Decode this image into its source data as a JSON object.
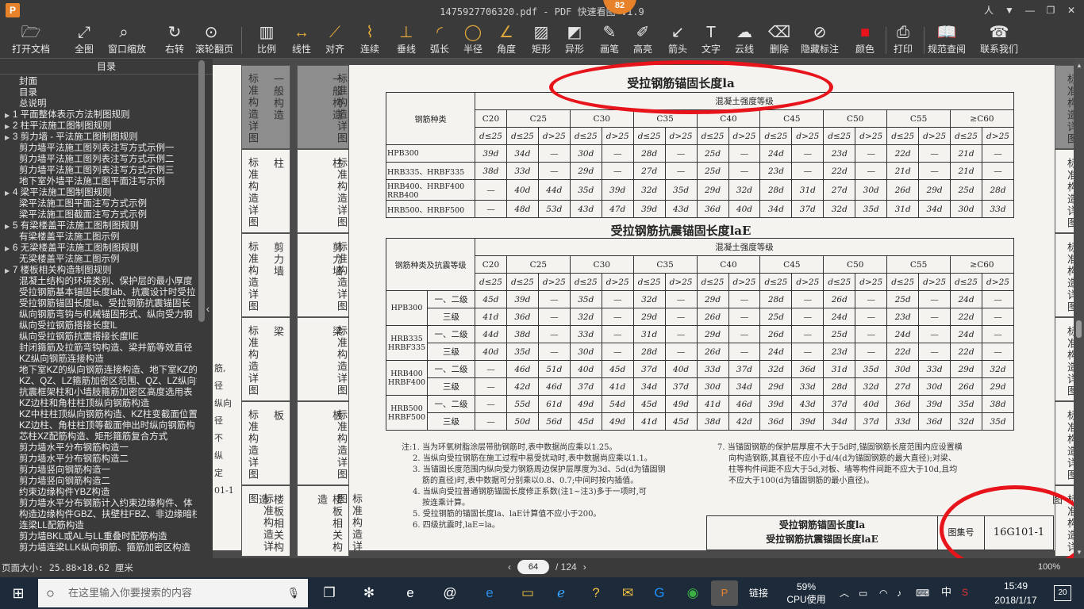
{
  "window": {
    "logo": "P",
    "title": "1475927706320.pdf - PDF 快速看图 v1.9",
    "badge": "82",
    "controls": [
      "人",
      "▼",
      "—",
      "❐",
      "✕"
    ]
  },
  "toolbar": [
    {
      "icon": "🗁",
      "label": "打开文档",
      "name": "open-document"
    },
    {
      "icon": "⤢",
      "label": "全图",
      "name": "fit-all"
    },
    {
      "icon": "⌕",
      "label": "窗口缩放",
      "name": "window-zoom"
    },
    {
      "icon": "↻",
      "label": "右转",
      "name": "rotate-right"
    },
    {
      "icon": "⊙",
      "label": "滚轮翻页",
      "name": "wheel-page"
    },
    {
      "icon": "▥",
      "label": "比例",
      "name": "scale"
    },
    {
      "icon": "↔",
      "label": "线性",
      "name": "linear"
    },
    {
      "icon": "⟋",
      "label": "对齐",
      "name": "align"
    },
    {
      "icon": "⌇",
      "label": "连续",
      "name": "continuous"
    },
    {
      "icon": "⊥",
      "label": "垂线",
      "name": "perpendicular"
    },
    {
      "icon": "◜",
      "label": "弧长",
      "name": "arc-length"
    },
    {
      "icon": "◯",
      "label": "半径",
      "name": "radius"
    },
    {
      "icon": "∠",
      "label": "角度",
      "name": "angle"
    },
    {
      "icon": "▨",
      "label": "矩形",
      "name": "rectangle"
    },
    {
      "icon": "◩",
      "label": "异形",
      "name": "irregular"
    },
    {
      "icon": "✎",
      "label": "画笔",
      "name": "brush"
    },
    {
      "icon": "✐",
      "label": "高亮",
      "name": "highlight"
    },
    {
      "icon": "↙",
      "label": "箭头",
      "name": "arrow"
    },
    {
      "icon": "T",
      "label": "文字",
      "name": "text"
    },
    {
      "icon": "☁",
      "label": "云线",
      "name": "cloud"
    },
    {
      "icon": "⌫",
      "label": "删除",
      "name": "delete"
    },
    {
      "icon": "⊘",
      "label": "隐藏标注",
      "name": "hide-annotation"
    },
    {
      "icon": "■",
      "label": "颜色",
      "name": "color"
    },
    {
      "icon": "⎙",
      "label": "打印",
      "name": "print"
    },
    {
      "icon": "📖",
      "label": "规范查阅",
      "name": "spec-lookup"
    },
    {
      "icon": "☎",
      "label": "联系我们",
      "name": "contact-us"
    }
  ],
  "sidebar": {
    "title": "目录",
    "items": [
      {
        "t": "封面",
        "c": false
      },
      {
        "t": "目录",
        "c": false
      },
      {
        "t": "总说明",
        "c": false
      },
      {
        "t": "1 平面整体表示方法制图规则",
        "c": true
      },
      {
        "t": "2 柱平法施工图制图规则",
        "c": true
      },
      {
        "t": "3 剪力墙 - 平法施工图制图规则",
        "c": true
      },
      {
        "t": "剪力墙平法施工图列表注写方式示例一",
        "c": false
      },
      {
        "t": "剪力墙平法施工图列表注写方式示例二",
        "c": false
      },
      {
        "t": "剪力墙平法施工图列表注写方式示例三",
        "c": false
      },
      {
        "t": "地下室外墙平法施工图平面注写示例",
        "c": false
      },
      {
        "t": "4 梁平法施工图制图规则",
        "c": true
      },
      {
        "t": "梁平法施工图平面注写方式示例",
        "c": false
      },
      {
        "t": "梁平法施工图截面注写方式示例",
        "c": false
      },
      {
        "t": "5 有梁楼盖平法施工图制图规则",
        "c": true
      },
      {
        "t": "有梁楼盖平法施工图示例",
        "c": false
      },
      {
        "t": "6 无梁楼盖平法施工图制图规则",
        "c": true
      },
      {
        "t": "无梁楼盖平法施工图示例",
        "c": false
      },
      {
        "t": "7 楼板相关构造制图规则",
        "c": true
      },
      {
        "t": "混凝土结构的环境类别、保护层的最小厚度",
        "c": false
      },
      {
        "t": "受拉钢筋基本锚固长度lab、抗震设计时受拉",
        "c": false
      },
      {
        "t": "受拉钢筋锚固长度la、受拉钢筋抗震锚固长",
        "c": false
      },
      {
        "t": "纵向钢筋弯钩与机械锚固形式、纵向受力钢",
        "c": false
      },
      {
        "t": "纵向受拉钢筋搭接长度lL",
        "c": false
      },
      {
        "t": "纵向受拉钢筋抗震搭接长度llE",
        "c": false
      },
      {
        "t": "封闭箍筋及拉筋弯钩构造、梁并筋等效直径",
        "c": false
      },
      {
        "t": "KZ纵向钢筋连接构造",
        "c": false
      },
      {
        "t": "地下室KZ的纵向钢筋连接构造、地下室KZ的",
        "c": false
      },
      {
        "t": "KZ、QZ、LZ箍筋加密区范围、QZ、LZ纵向钢",
        "c": false
      },
      {
        "t": "抗震框架柱和小墙肢箍筋加密区高度选用表",
        "c": false
      },
      {
        "t": "KZ边柱和角柱柱顶纵向钢筋构造",
        "c": false
      },
      {
        "t": "KZ中柱柱顶纵向钢筋构造、KZ柱变截面位置",
        "c": false
      },
      {
        "t": "KZ边柱、角柱柱顶等截面伸出时纵向钢筋构",
        "c": false
      },
      {
        "t": "芯柱XZ配筋构造、矩形箍筋复合方式",
        "c": false
      },
      {
        "t": "剪力墙水平分布钢筋构造一",
        "c": false
      },
      {
        "t": "剪力墙水平分布钢筋构造二",
        "c": false
      },
      {
        "t": "剪力墙竖向钢筋构造一",
        "c": false
      },
      {
        "t": "剪力墙竖向钢筋构造二",
        "c": false
      },
      {
        "t": "约束边缘构件YBZ构造",
        "c": false
      },
      {
        "t": "剪力墙水平分布钢筋计入约束边缘构件、体",
        "c": false
      },
      {
        "t": "构造边缘构件GBZ、扶壁柱FBZ、非边缘暗柱",
        "c": false
      },
      {
        "t": "连梁LL配筋构造",
        "c": false
      },
      {
        "t": "剪力墙BKL或AL与LL重叠时配筋构造",
        "c": false
      },
      {
        "t": "剪力墙连梁LLK纵向钢筋、箍筋加密区构造",
        "c": false
      }
    ]
  },
  "page": {
    "side_tabs": [
      "标准构造详图",
      "柱",
      "剪力墙",
      "梁",
      "板",
      "楼板相关构造"
    ],
    "side_tab_heads": [
      "一般构造",
      "柱",
      "剪力墙",
      "梁",
      "板",
      "楼板相关构造"
    ],
    "left_fragments": [
      "筋,",
      "径",
      "纵向",
      "径",
      "不",
      "纵",
      "定",
      "01-1"
    ],
    "title1": "受拉钢筋锚固长度la",
    "title2": "受拉钢筋抗震锚固长度laE",
    "concrete_grade": "混凝土强度等级",
    "bar_type": "钢筋种类",
    "bar_type_seismic": "钢筋种类及抗震等级",
    "grades": [
      "C20",
      "C25",
      "C30",
      "C35",
      "C40",
      "C45",
      "C50",
      "C55",
      "≥C60"
    ],
    "d_le": "d≤25",
    "d_gt": "d>25",
    "table1": [
      {
        "type": "HPB300",
        "cells": [
          "39d",
          "34d",
          "—",
          "30d",
          "—",
          "28d",
          "—",
          "25d",
          "—",
          "24d",
          "—",
          "23d",
          "—",
          "22d",
          "—",
          "21d",
          "—"
        ]
      },
      {
        "type": "HRB335、HRBF335",
        "cells": [
          "38d",
          "33d",
          "—",
          "29d",
          "—",
          "27d",
          "—",
          "25d",
          "—",
          "23d",
          "—",
          "22d",
          "—",
          "21d",
          "—",
          "21d",
          "—"
        ]
      },
      {
        "type": "HRB400、HRBF400 RRB400",
        "cells": [
          "—",
          "40d",
          "44d",
          "35d",
          "39d",
          "32d",
          "35d",
          "29d",
          "32d",
          "28d",
          "31d",
          "27d",
          "30d",
          "26d",
          "29d",
          "25d",
          "28d"
        ]
      },
      {
        "type": "HRB500、HRBF500",
        "cells": [
          "—",
          "48d",
          "53d",
          "43d",
          "47d",
          "39d",
          "43d",
          "36d",
          "40d",
          "34d",
          "37d",
          "32d",
          "35d",
          "31d",
          "34d",
          "30d",
          "33d"
        ]
      }
    ],
    "table2": [
      {
        "type": "HPB300",
        "rows": [
          {
            "lvl": "一、二级",
            "cells": [
              "45d",
              "39d",
              "—",
              "35d",
              "—",
              "32d",
              "—",
              "29d",
              "—",
              "28d",
              "—",
              "26d",
              "—",
              "25d",
              "—",
              "24d",
              "—"
            ]
          },
          {
            "lvl": "三级",
            "cells": [
              "41d",
              "36d",
              "—",
              "32d",
              "—",
              "29d",
              "—",
              "26d",
              "—",
              "25d",
              "—",
              "24d",
              "—",
              "23d",
              "—",
              "22d",
              "—"
            ]
          }
        ]
      },
      {
        "type": "HRB335 HRBF335",
        "rows": [
          {
            "lvl": "一、二级",
            "cells": [
              "44d",
              "38d",
              "—",
              "33d",
              "—",
              "31d",
              "—",
              "29d",
              "—",
              "26d",
              "—",
              "25d",
              "—",
              "24d",
              "—",
              "24d",
              "—"
            ]
          },
          {
            "lvl": "三级",
            "cells": [
              "40d",
              "35d",
              "—",
              "30d",
              "—",
              "28d",
              "—",
              "26d",
              "—",
              "24d",
              "—",
              "23d",
              "—",
              "22d",
              "—",
              "22d",
              "—"
            ]
          }
        ]
      },
      {
        "type": "HRB400 HRBF400",
        "rows": [
          {
            "lvl": "一、二级",
            "cells": [
              "—",
              "46d",
              "51d",
              "40d",
              "45d",
              "37d",
              "40d",
              "33d",
              "37d",
              "32d",
              "36d",
              "31d",
              "35d",
              "30d",
              "33d",
              "29d",
              "32d"
            ]
          },
          {
            "lvl": "三级",
            "cells": [
              "—",
              "42d",
              "46d",
              "37d",
              "41d",
              "34d",
              "37d",
              "30d",
              "34d",
              "29d",
              "33d",
              "28d",
              "32d",
              "27d",
              "30d",
              "26d",
              "29d"
            ]
          }
        ]
      },
      {
        "type": "HRB500 HRBF500",
        "rows": [
          {
            "lvl": "一、二级",
            "cells": [
              "—",
              "55d",
              "61d",
              "49d",
              "54d",
              "45d",
              "49d",
              "41d",
              "46d",
              "39d",
              "43d",
              "37d",
              "40d",
              "36d",
              "39d",
              "35d",
              "38d"
            ]
          },
          {
            "lvl": "三级",
            "cells": [
              "—",
              "50d",
              "56d",
              "45d",
              "49d",
              "41d",
              "45d",
              "38d",
              "42d",
              "36d",
              "39d",
              "34d",
              "37d",
              "33d",
              "36d",
              "32d",
              "35d"
            ]
          }
        ]
      }
    ],
    "notes_left": [
      "注:1. 当为环氧树脂涂层带肋钢筋时,表中数据尚应乘以1.25。",
      "2. 当纵向受拉钢筋在施工过程中易受扰动时,表中数据尚应乘以1.1。",
      "3. 当锚固长度范围内纵向受力钢筋周边保护层厚度为3d、5d(d为锚固钢",
      "筋的直径)时,表中数据可分别乘以0.8、0.7;中间时按内插值。",
      "4. 当纵向受拉普通钢筋锚固长度修正系数(注1~注3)多于一项时,可",
      "按连乘计算。",
      "5. 受拉钢筋的锚固长度la、laE计算值不应小于200。",
      "6. 四级抗震时,laE=la。"
    ],
    "notes_right": [
      "7. 当锚固钢筋的保护层厚度不大于5d时,锚固钢筋长度范围内应设置横",
      "向构造钢筋,其直径不应小于d/4(d为锚固钢筋的最大直径);对梁、",
      "柱等构件间距不应大于5d,对板、墙等构件间距不应大于10d,且均",
      "不应大于100(d为锚固钢筋的最小直径)。"
    ],
    "titleblock": {
      "line1": "受拉钢筋锚固长度la",
      "line2": "受拉钢筋抗震锚固长度laE",
      "atlas_label": "图集号",
      "atlas_no": "16G101-1"
    },
    "right_tabs": [
      "标准构造详图",
      "标准构造详图",
      "标准构造详图",
      "标准构造详图",
      "标准构造详图",
      "标准构造详图"
    ]
  },
  "status": {
    "page_size": "页面大小: 25.88×18.62 厘米",
    "current_page": "64",
    "total_pages": "/ 124",
    "zoom": "100%"
  },
  "taskbar": {
    "search_placeholder": "在这里输入你要搜索的内容",
    "link": "链接",
    "cpu": "59%",
    "cpu_label": "CPU使用",
    "ime": "中",
    "time": "15:49",
    "date": "2018/1/17",
    "notif_count": "20"
  },
  "colors": {
    "annotation_red": "#e8141b",
    "accent_orange": "#e8822a"
  }
}
